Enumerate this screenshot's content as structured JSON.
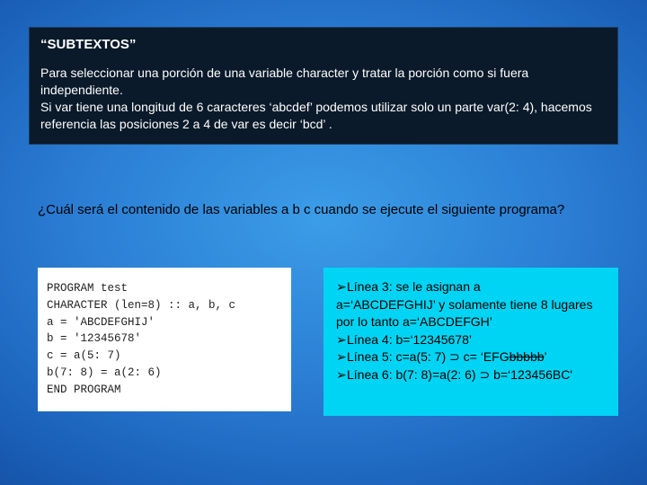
{
  "darkBox": {
    "title": "“SUBTEXTOS”",
    "p1": "Para seleccionar una porción de una variable  character y tratar la porción como si fuera independiente.",
    "p2": "Si var tiene una longitud de 6 caracteres ‘abcdef’ podemos utilizar solo un parte var(2: 4), hacemos referencia las posiciones 2 a 4 de var es decir  ‘bcd’ ."
  },
  "question": "¿Cuál será el contenido de las variables a b c cuando se ejecute el siguiente programa?",
  "code": "PROGRAM test\nCHARACTER (len=8) :: a, b, c\na = 'ABCDEFGHIJ'\nb = '12345678'\nc = a(5: 7)\nb(7: 8) = a(2: 6)\nEND PROGRAM",
  "cyan": {
    "l1a": "Línea 3: se le asignan a",
    "l1b": "a=‘ABCDEFGHIJ’ y solamente tiene 8 lugares por lo tanto a=‘ABCDEFGH’",
    "l2": "Línea 4: b=‘12345678’",
    "l3a": "Línea 5: c=a(5: 7) ⊃  c= ‘EFG",
    "l3strike": "bbbbb",
    "l3b": "’",
    "l4": "Línea 6:  b(7: 8)=a(2: 6) ⊃  b=‘123456BC'"
  },
  "bullet": "➢"
}
